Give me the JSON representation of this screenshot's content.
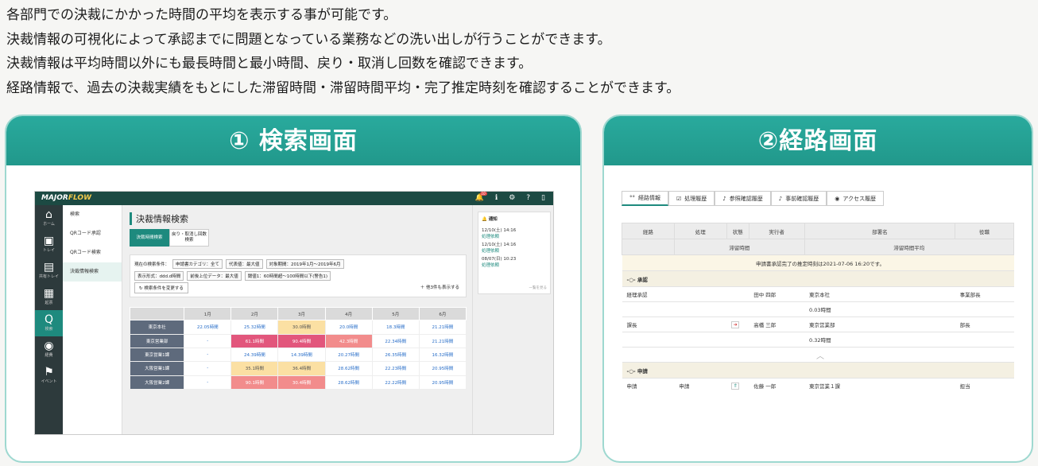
{
  "intro": [
    "各部門での決裁にかかった時間の平均を表示する事が可能です。",
    "決裁情報の可視化によって承認までに問題となっている業務などの洗い出しが行うことができます。",
    "決裁情報は平均時間以外にも最長時間と最小時間、戻り・取消し回数を確認できます。",
    "経路情報で、過去の決裁実績をもとにした滞留時間・滞留時間平均・完了推定時刻を確認することができます。"
  ],
  "card1": {
    "title": "① 検索画面",
    "logo_a": "MAJOR",
    "logo_b": "FLOW",
    "badge": "10",
    "nav": [
      {
        "icon": "⌂",
        "label": "ホーム"
      },
      {
        "icon": "▣",
        "label": "トレイ"
      },
      {
        "icon": "▤",
        "label": "共有トレイ"
      },
      {
        "icon": "▦",
        "label": "起票"
      },
      {
        "icon": "Q",
        "label": "検索"
      },
      {
        "icon": "◉",
        "label": "経費"
      },
      {
        "icon": "⚑",
        "label": "イベント"
      }
    ],
    "submenu": [
      "検索",
      "QRコード承認",
      "QRコード検索",
      "決裁情報検索"
    ],
    "page_title": "決裁情報検索",
    "tabs": [
      "決裁時間検索",
      "戻り・取消し回数\n検索"
    ],
    "cond_row1": [
      "現在の検索条件：",
      "申請書カテゴリ：全て",
      "代表値：最大値",
      "対象期間：2019年1月～2019年6月"
    ],
    "cond_row2": [
      "表示形式：ddd.d時間",
      "前後上位データ：最大値",
      "閾値1：60時間超～100時間以下(警告1)"
    ],
    "cond_button": "検索条件を変更する",
    "cond_more": "＋ 他3件も表示する",
    "grid_head": [
      "",
      "1月",
      "2月",
      "3月",
      "4月",
      "5月",
      "6月"
    ],
    "grid_rows": [
      {
        "name": "東京本社",
        "cells": [
          "22.05時間",
          "25.32時間",
          "30.0時間",
          "20.0時間",
          "18.3時間",
          "21.21時間"
        ],
        "cls": [
          "",
          "",
          "c-y",
          "",
          "",
          ""
        ]
      },
      {
        "name": "東京営業部",
        "cells": [
          "-",
          "61.1時間",
          "90.4時間",
          "42.3時間",
          "22.34時間",
          "21.21時間"
        ],
        "cls": [
          "",
          "c-p",
          "c-p",
          "c-s",
          "",
          ""
        ]
      },
      {
        "name": "東京営業1課",
        "cells": [
          "-",
          "24.39時間",
          "14.39時間",
          "20.27時間",
          "26.35時間",
          "16.32時間"
        ],
        "cls": [
          "",
          "",
          "",
          "",
          "",
          ""
        ]
      },
      {
        "name": "大阪営業1課",
        "cells": [
          "-",
          "35.1時間",
          "36.4時間",
          "28.62時間",
          "22.23時間",
          "20.95時間"
        ],
        "cls": [
          "",
          "c-y",
          "c-y",
          "",
          "",
          ""
        ]
      },
      {
        "name": "大阪営業2課",
        "cells": [
          "-",
          "90.1時間",
          "30.4時間",
          "28.62時間",
          "22.22時間",
          "20.95時間"
        ],
        "cls": [
          "",
          "c-s",
          "c-s",
          "",
          "",
          ""
        ]
      }
    ],
    "notice_title": "通知",
    "notices": [
      {
        "date": "12/10(土) 14:16",
        "text": "処理依頼"
      },
      {
        "date": "12/10(土) 14:16",
        "text": "処理依頼"
      },
      {
        "date": "08/07(日) 10:23",
        "text": "処理依頼"
      }
    ],
    "notice_all": "一覧を見る"
  },
  "card2": {
    "title": "②経路画面",
    "tabs": [
      {
        "icon": "°°",
        "label": "経路情報"
      },
      {
        "icon": "☑",
        "label": "処理履歴"
      },
      {
        "icon": "♪",
        "label": "参照確認履歴"
      },
      {
        "icon": "♪",
        "label": "事前確認履歴"
      },
      {
        "icon": "◉",
        "label": "アクセス履歴"
      }
    ],
    "head1": [
      "経路",
      "処理",
      "状態",
      "実行者",
      "部署名",
      "役職"
    ],
    "head2": [
      "滞留時間",
      "滞留時間平均"
    ],
    "estimate": "申請書承認完了の推定時刻は2021-07-06 16:20です。",
    "group1": "承認",
    "rows1": [
      {
        "route": "経理承認",
        "proc": "",
        "state": "",
        "user": "田中 四郎",
        "dept": "東京本社",
        "pos": "事業部長",
        "time": "0.03時間"
      },
      {
        "route": "課長",
        "proc": "",
        "state": "➜",
        "user": "高橋 三郎",
        "dept": "東京営業部",
        "pos": "部長",
        "time": "0.32時間"
      }
    ],
    "group2": "申請",
    "rows2": [
      {
        "route": "申請",
        "proc": "申請",
        "state": "⇑",
        "user": "佐藤 一郎",
        "dept": "東京営業１課",
        "pos": "担当"
      }
    ]
  }
}
